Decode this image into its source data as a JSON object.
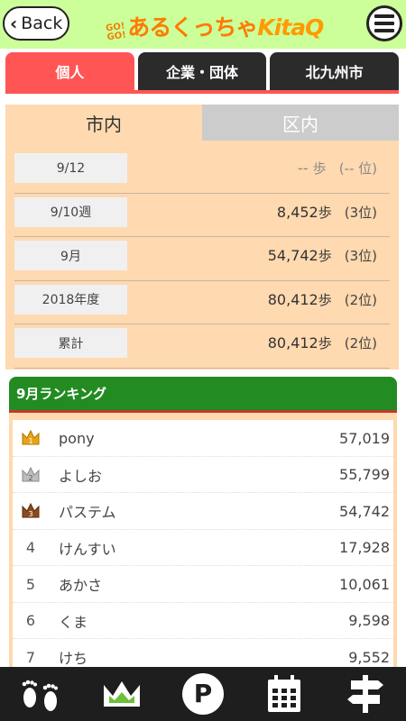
{
  "header": {
    "back_label": "Back",
    "logo_goco_top": "GO!",
    "logo_goco_bottom": "GO!",
    "logo_main": "あるくっちゃ",
    "logo_kitaq": "KitaQ",
    "menu_icon": "hamburger-menu-icon"
  },
  "category_tabs": [
    {
      "label": "個人",
      "active": true
    },
    {
      "label": "企業・団体",
      "active": false
    },
    {
      "label": "北九州市",
      "active": false
    }
  ],
  "area_tabs": [
    {
      "label": "市内",
      "active": true
    },
    {
      "label": "区内",
      "active": false
    }
  ],
  "stats": [
    {
      "period": "9/12",
      "steps": "--",
      "unit": "歩",
      "rank": "(-- 位)"
    },
    {
      "period": "9/10週",
      "steps": "8,452",
      "unit": "歩",
      "rank": "(3位)"
    },
    {
      "period": "9月",
      "steps": "54,742",
      "unit": "歩",
      "rank": "(3位)"
    },
    {
      "period": "2018年度",
      "steps": "80,412",
      "unit": "歩",
      "rank": "(2位)"
    },
    {
      "period": "累計",
      "steps": "80,412",
      "unit": "歩",
      "rank": "(2位)"
    }
  ],
  "ranking": {
    "title": "9月ランキング",
    "rows": [
      {
        "position": "1",
        "medal": "gold",
        "name": "pony",
        "steps": "57,019"
      },
      {
        "position": "2",
        "medal": "silver",
        "name": "よしお",
        "steps": "55,799"
      },
      {
        "position": "3",
        "medal": "bronze",
        "name": "パステム",
        "steps": "54,742"
      },
      {
        "position": "4",
        "medal": "",
        "name": "けんすい",
        "steps": "17,928"
      },
      {
        "position": "5",
        "medal": "",
        "name": "あかさ",
        "steps": "10,061"
      },
      {
        "position": "6",
        "medal": "",
        "name": "くま",
        "steps": "9,598"
      },
      {
        "position": "7",
        "medal": "",
        "name": "けち",
        "steps": "9,552"
      }
    ]
  },
  "bottom_nav": [
    {
      "icon": "footprints-icon"
    },
    {
      "icon": "crown-icon"
    },
    {
      "icon": "parking-icon"
    },
    {
      "icon": "calendar-icon"
    },
    {
      "icon": "signpost-icon"
    }
  ],
  "colors": {
    "header_bg": "#ccff99",
    "accent_red": "#ff5555",
    "panel_peach": "#ffd9b0",
    "ranking_green": "#228b22",
    "nav_dark": "#1e1e1e"
  }
}
